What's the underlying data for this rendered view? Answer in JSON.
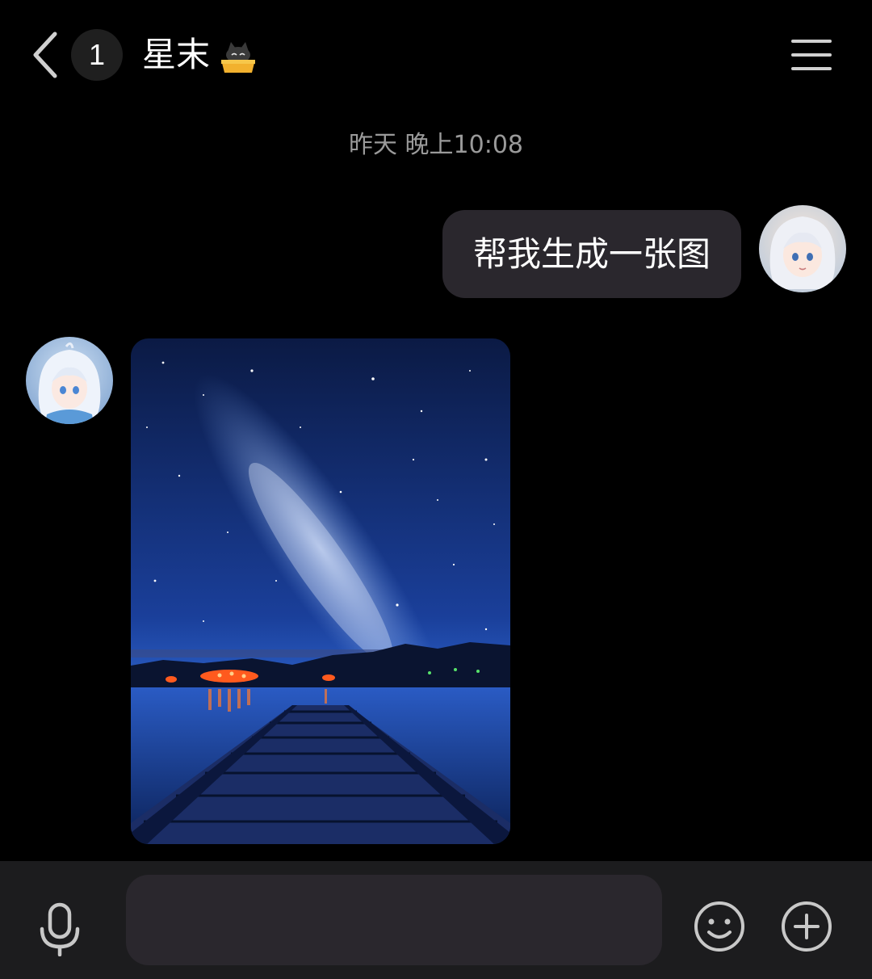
{
  "header": {
    "back_icon": "chevron-left-icon",
    "unread_count": "1",
    "title": "星末",
    "title_badge_icon": "cat-in-box-icon",
    "menu_icon": "hamburger-menu-icon"
  },
  "chat": {
    "time_separator": "昨天 晚上10:08",
    "messages": [
      {
        "from": "me",
        "type": "text",
        "text": "帮我生成一张图"
      },
      {
        "from": "bot",
        "type": "image"
      }
    ]
  },
  "input_bar": {
    "voice_icon": "microphone-icon",
    "input_value": "",
    "emoji_icon": "smiley-icon",
    "more_icon": "plus-circle-icon"
  },
  "colors": {
    "background": "#000000",
    "bubble": "#2a272d",
    "input_bar": "#1c1c1e",
    "timestamp": "#9a9a9a"
  }
}
